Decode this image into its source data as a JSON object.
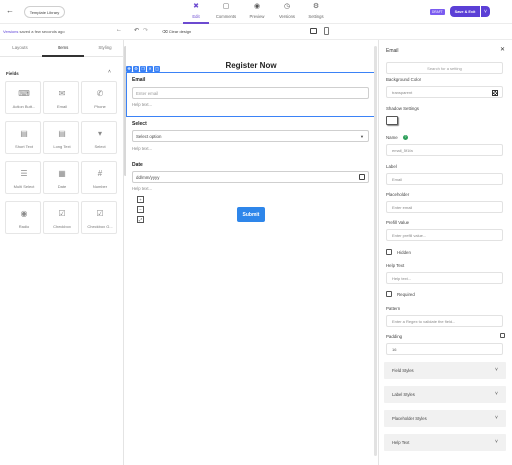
{
  "topbar": {
    "back_icon": "arrow-left-icon",
    "template_library": "Template Library",
    "tabs": [
      {
        "label": "Edit",
        "icon": "edit-icon",
        "active": true
      },
      {
        "label": "Comments",
        "icon": "comment-icon",
        "active": false
      },
      {
        "label": "Preview",
        "icon": "eye-icon",
        "active": false
      },
      {
        "label": "Versions",
        "icon": "history-icon",
        "active": false
      },
      {
        "label": "Settings",
        "icon": "gear-icon",
        "active": false
      }
    ],
    "draft_badge": "DRAFT",
    "save_label": "Save & Exit",
    "accent": "#5b3fd6"
  },
  "subbar": {
    "versions_link": "Versions",
    "versions_status": "saved a few seconds ago",
    "clear_design": "Clear design"
  },
  "left_panel": {
    "tabs": [
      "Layouts",
      "Items",
      "Styling"
    ],
    "active_tab": "Items",
    "fields_heading": "Fields",
    "tiles": [
      {
        "label": "Action Butt...",
        "icon": "keyboard-icon"
      },
      {
        "label": "Email",
        "icon": "envelope-icon"
      },
      {
        "label": "Phone",
        "icon": "phone-icon"
      },
      {
        "label": "Short Text",
        "icon": "short-text-icon"
      },
      {
        "label": "Long Text",
        "icon": "long-text-icon"
      },
      {
        "label": "Select",
        "icon": "select-icon"
      },
      {
        "label": "Multi Select",
        "icon": "multi-select-icon"
      },
      {
        "label": "Date",
        "icon": "calendar-icon"
      },
      {
        "label": "Number",
        "icon": "number-icon"
      },
      {
        "label": "Radio",
        "icon": "radio-icon"
      },
      {
        "label": "Checkbox",
        "icon": "checkbox-icon"
      },
      {
        "label": "Checkbox G...",
        "icon": "checkbox-group-icon"
      }
    ]
  },
  "canvas": {
    "form_title": "Register Now",
    "email": {
      "label": "Email",
      "placeholder": "Enter email",
      "help": "Help text..."
    },
    "select": {
      "label": "Select",
      "value": "Select option",
      "help": "Help text..."
    },
    "date": {
      "label": "Date",
      "value": "dd/mm/yyyy",
      "help": "Help text..."
    },
    "submit": "Submit"
  },
  "right_panel": {
    "title": "Email",
    "search_placeholder": "Search for a setting",
    "background_color_label": "Background Color",
    "background_color_value": "transparent",
    "shadow_settings_label": "Shadow Settings",
    "name_label": "Name",
    "name_value": "email_5f1fa",
    "label_label": "Label",
    "label_value": "Email",
    "placeholder_label": "Placeholder",
    "placeholder_value": "Enter email",
    "prefill_label": "Prefill Value",
    "prefill_placeholder": "Enter prefill value...",
    "hidden_label": "Hidden",
    "help_text_label": "Help Text",
    "help_text_value": "Help text...",
    "required_label": "Required",
    "pattern_label": "Pattern",
    "pattern_placeholder": "Enter a Regex to validate the field...",
    "padding_label": "Padding",
    "padding_value": "16",
    "accordions": [
      "Field Styles",
      "Label Styles",
      "Placeholder Styles",
      "Help Text"
    ]
  }
}
